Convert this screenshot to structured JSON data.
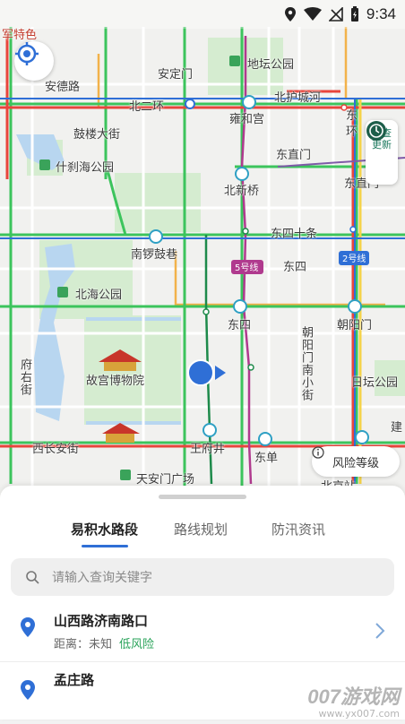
{
  "status_bar": {
    "time": "9:34"
  },
  "map": {
    "labels": {
      "jsx": "军特色",
      "anding_rd": "安德路",
      "andingmen": "安定门",
      "ditan_park": "地坛公园",
      "beierhuan": "北二环",
      "beihuchenghe": "北护城河",
      "yonghegong": "雍和宫",
      "gulou": "鼓楼大街",
      "dongzhimen": "东直门",
      "shichahai": "什刹海公园",
      "beixinqiao": "北新桥",
      "dongzhimen2": "东直门",
      "dongsishitiao": "东四十条",
      "nanluoguxiang": "南锣鼓巷",
      "line2": "2号线",
      "line5": "5号线",
      "dongsi_area": "东四",
      "beihai": "北海公园",
      "dongsi_station": "东四",
      "chaoyangmen": "朝阳门",
      "chaoyangmen_st": "朝阳门南小街",
      "fuyoujie": "府右街",
      "palace": "故宫博物院",
      "ritan": "日坛公园",
      "wangfujing": "王府井",
      "dongdan": "东单",
      "xichangan": "西长安街",
      "tiananmen": "天安门广场",
      "beijingzhan": "北京站",
      "jian": "建",
      "dong_huan_1": "东",
      "dong_huan_2": "环"
    },
    "check_update": "检查更新",
    "risk_level": "风险等级"
  },
  "sheet": {
    "tabs": [
      "易积水路段",
      "路线规划",
      "防汛资讯"
    ],
    "active_tab": 0,
    "search_placeholder": "请输入查询关键字",
    "items": [
      {
        "title": "山西路济南路口",
        "distance_label": "距离：未知",
        "risk": "低风险"
      },
      {
        "title": "孟庄路"
      }
    ]
  },
  "watermark": {
    "big": "007游戏网",
    "small": "www.yx007.com"
  },
  "colors": {
    "accent": "#2f6fd6",
    "low_risk": "#2aa35a",
    "road_red": "#e8453c",
    "road_green": "#3cc45c",
    "line5": "#b03a8e",
    "line2": "#2f6fd6"
  }
}
